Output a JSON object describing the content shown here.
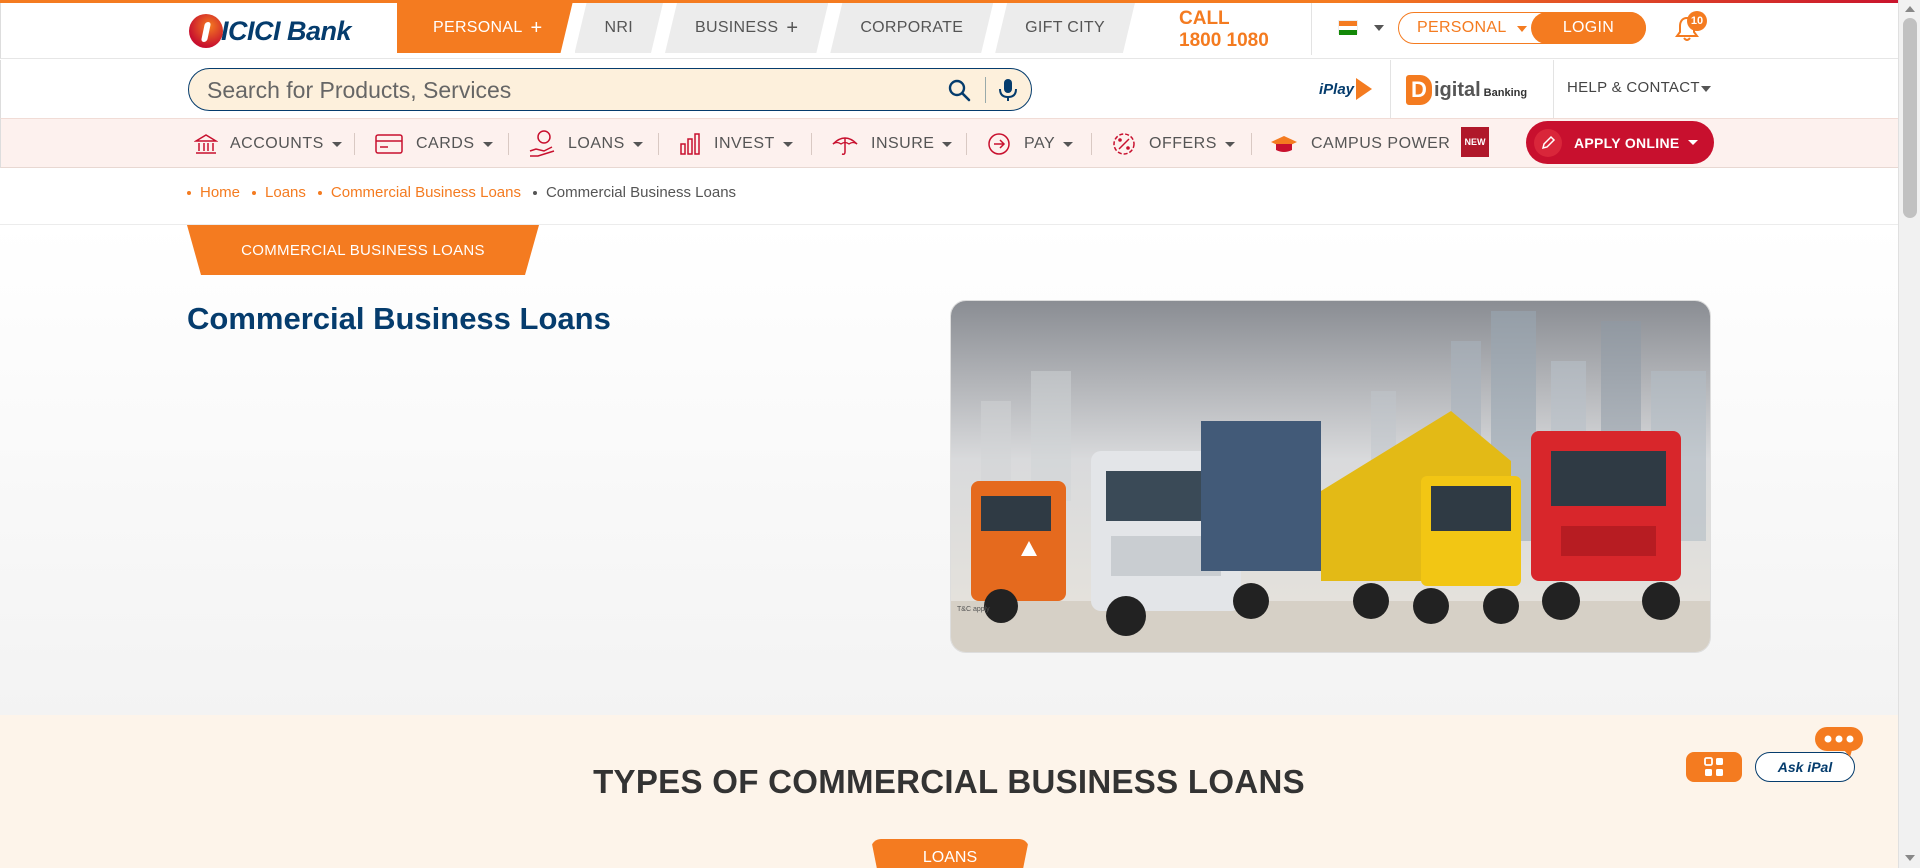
{
  "brand": {
    "name": "ICICI Bank"
  },
  "segments": [
    {
      "label": "PERSONAL",
      "active": true,
      "plus": "+"
    },
    {
      "label": "NRI"
    },
    {
      "label": "BUSINESS",
      "plus": "+"
    },
    {
      "label": "CORPORATE"
    },
    {
      "label": "GIFT CITY"
    }
  ],
  "call": {
    "line1": "CALL",
    "line2": "1800 1080"
  },
  "header": {
    "personal_dropdown": "PERSONAL",
    "login": "LOGIN",
    "notification_count": "10"
  },
  "search": {
    "placeholder": "Search for Products, Services"
  },
  "quick_links": {
    "iplay": "iPlay",
    "digital_d": "D",
    "digital": "igital",
    "digital_sub": "Banking",
    "help": "HELP & CONTACT"
  },
  "nav": {
    "items": [
      {
        "label": "ACCOUNTS"
      },
      {
        "label": "CARDS"
      },
      {
        "label": "LOANS"
      },
      {
        "label": "INVEST"
      },
      {
        "label": "INSURE"
      },
      {
        "label": "PAY"
      },
      {
        "label": "OFFERS"
      },
      {
        "label": "CAMPUS POWER"
      }
    ],
    "new_badge": "NEW",
    "apply_online": "APPLY ONLINE"
  },
  "breadcrumb": [
    "Home",
    "Loans",
    "Commercial Business Loans",
    "Commercial Business Loans"
  ],
  "hero": {
    "tab": "COMMERCIAL BUSINESS LOANS",
    "title": "Commercial Business Loans",
    "image_caption": "T&C apply"
  },
  "types": {
    "title": "TYPES OF COMMERCIAL BUSINESS LOANS",
    "tab": "LOANS"
  },
  "floating": {
    "askipal": "Ask iPal"
  },
  "colors": {
    "brand_orange": "#f47b20",
    "brand_navy": "#053c6d",
    "brand_red": "#c8102e"
  }
}
